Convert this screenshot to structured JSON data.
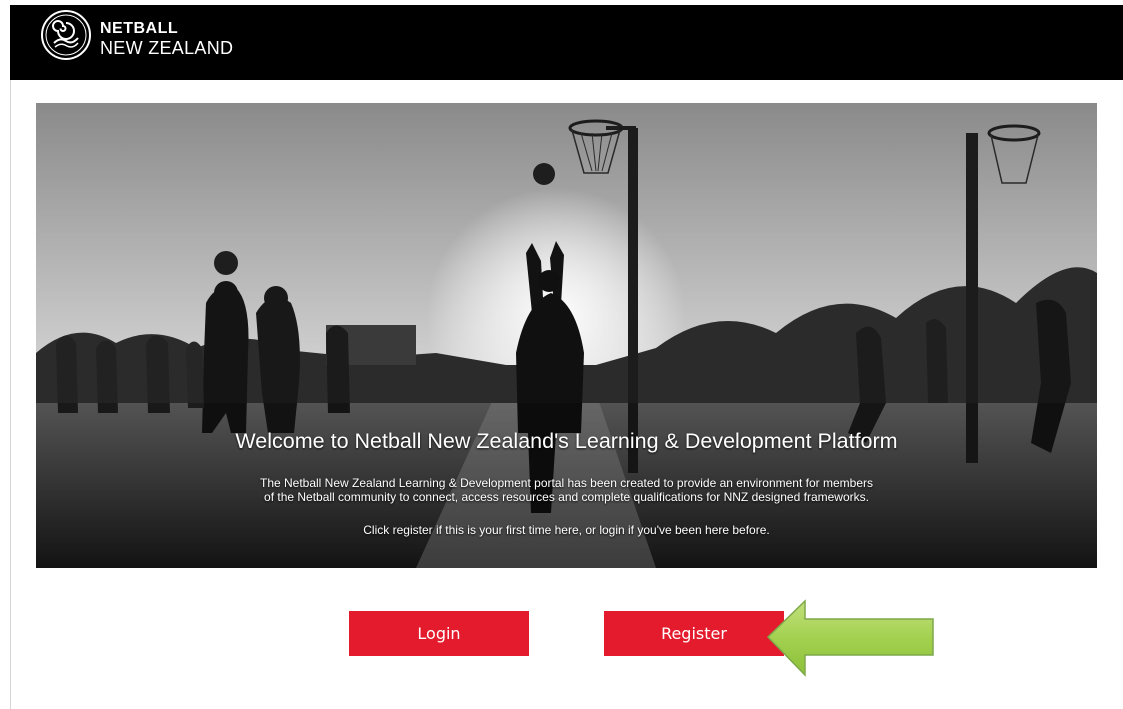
{
  "brand": {
    "name_line1": "NETBALL",
    "name_line2": "NEW ZEALAND",
    "logo_icon": "netball-ribbon-logo-icon"
  },
  "hero": {
    "title": "Welcome to Netball New Zealand's Learning & Development Platform",
    "description_line1": "The Netball New Zealand Learning & Development portal has been created to provide an environment for members",
    "description_line2": "of the Netball community to connect, access resources and complete qualifications for NNZ designed frameworks.",
    "cta_text": "Click register if this is your first time here, or login if you've been here before.",
    "image": "black-and-white photo of outdoor netball courts at sunset with players and hoops"
  },
  "actions": {
    "login_label": "Login",
    "register_label": "Register",
    "pointer_icon": "arrow-left-icon"
  },
  "colors": {
    "topbar": "#000000",
    "button": "#e31b2c",
    "arrow": "#9ccd4a"
  }
}
